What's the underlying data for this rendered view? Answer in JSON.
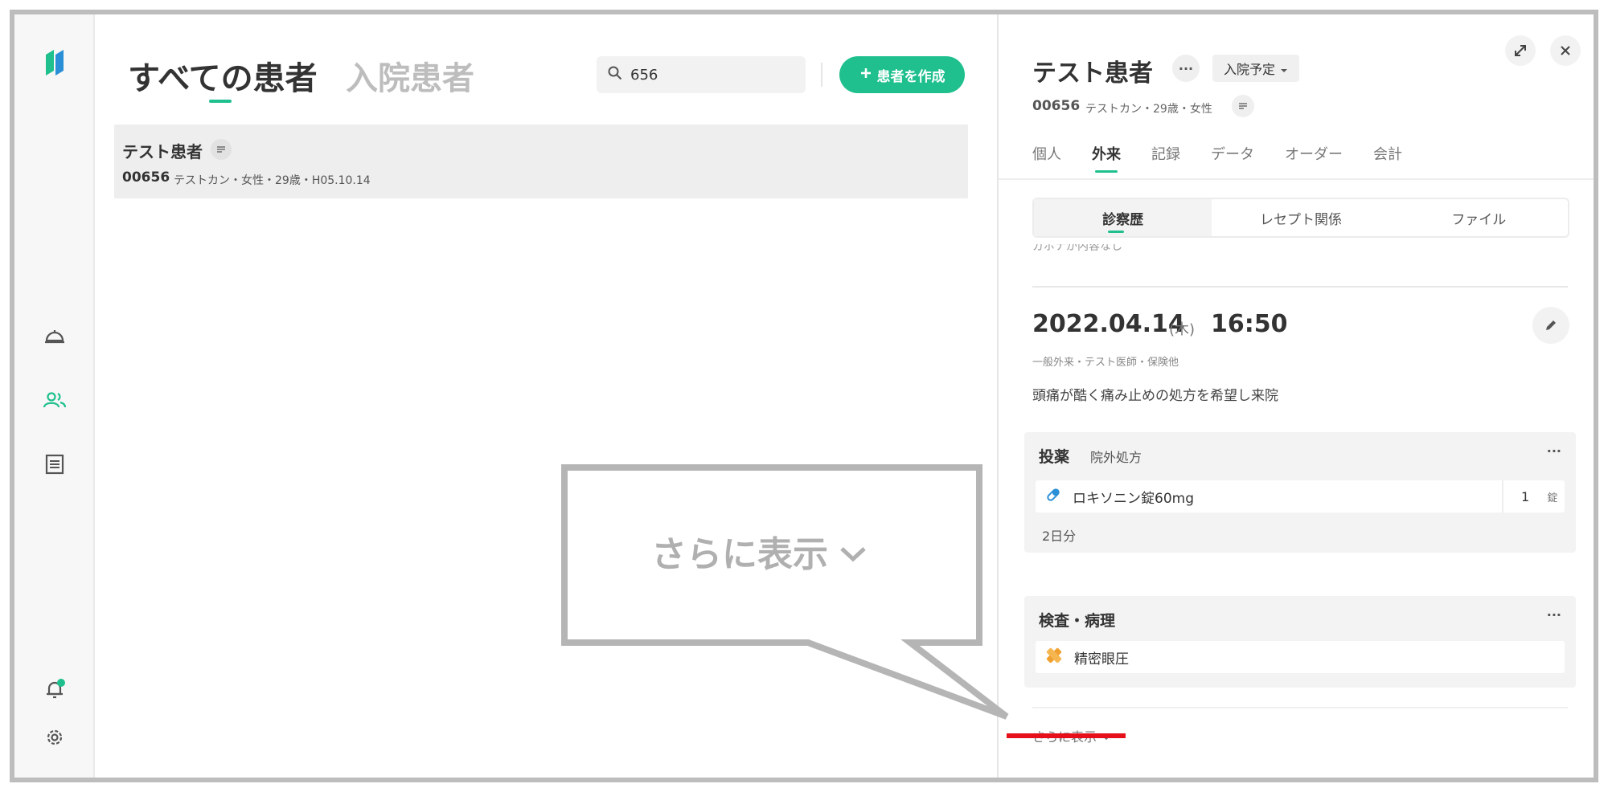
{
  "main": {
    "tab_all": "すべての患者",
    "tab_inpatient": "入院患者",
    "search_value": "656",
    "create_button": "患者を作成"
  },
  "patient_list": [
    {
      "name": "テスト患者",
      "id": "00656",
      "meta": "テストカン・女性・29歳・H05.10.14"
    }
  ],
  "panel": {
    "name": "テスト患者",
    "more": "···",
    "status": "入院予定",
    "id": "00656",
    "meta": "テストカン・29歳・女性",
    "tabs": [
      "個人",
      "外来",
      "記録",
      "データ",
      "オーダー",
      "会計"
    ],
    "subtabs": [
      "診察歴",
      "レセプト関係",
      "ファイル"
    ],
    "partial_text": "ガボナが内容なし",
    "visit": {
      "date": "2022.04.14",
      "dow": "(木)",
      "time": "16:50",
      "meta": "一般外来・テスト医師・保険他",
      "note": "頭痛が酷く痛み止めの処方を希望し来院"
    },
    "medication": {
      "title": "投薬",
      "sub": "院外処方",
      "more": "···",
      "item": "ロキソニン錠60mg",
      "qty": "1",
      "unit": "錠",
      "days": "2日分"
    },
    "exam": {
      "title": "検査・病理",
      "more": "···",
      "item": "精密眼圧"
    },
    "show_more": "さらに表示"
  },
  "callout": {
    "text": "さらに表示"
  },
  "colors": {
    "accent": "#1fc08e",
    "highlight": "#e5101a"
  }
}
